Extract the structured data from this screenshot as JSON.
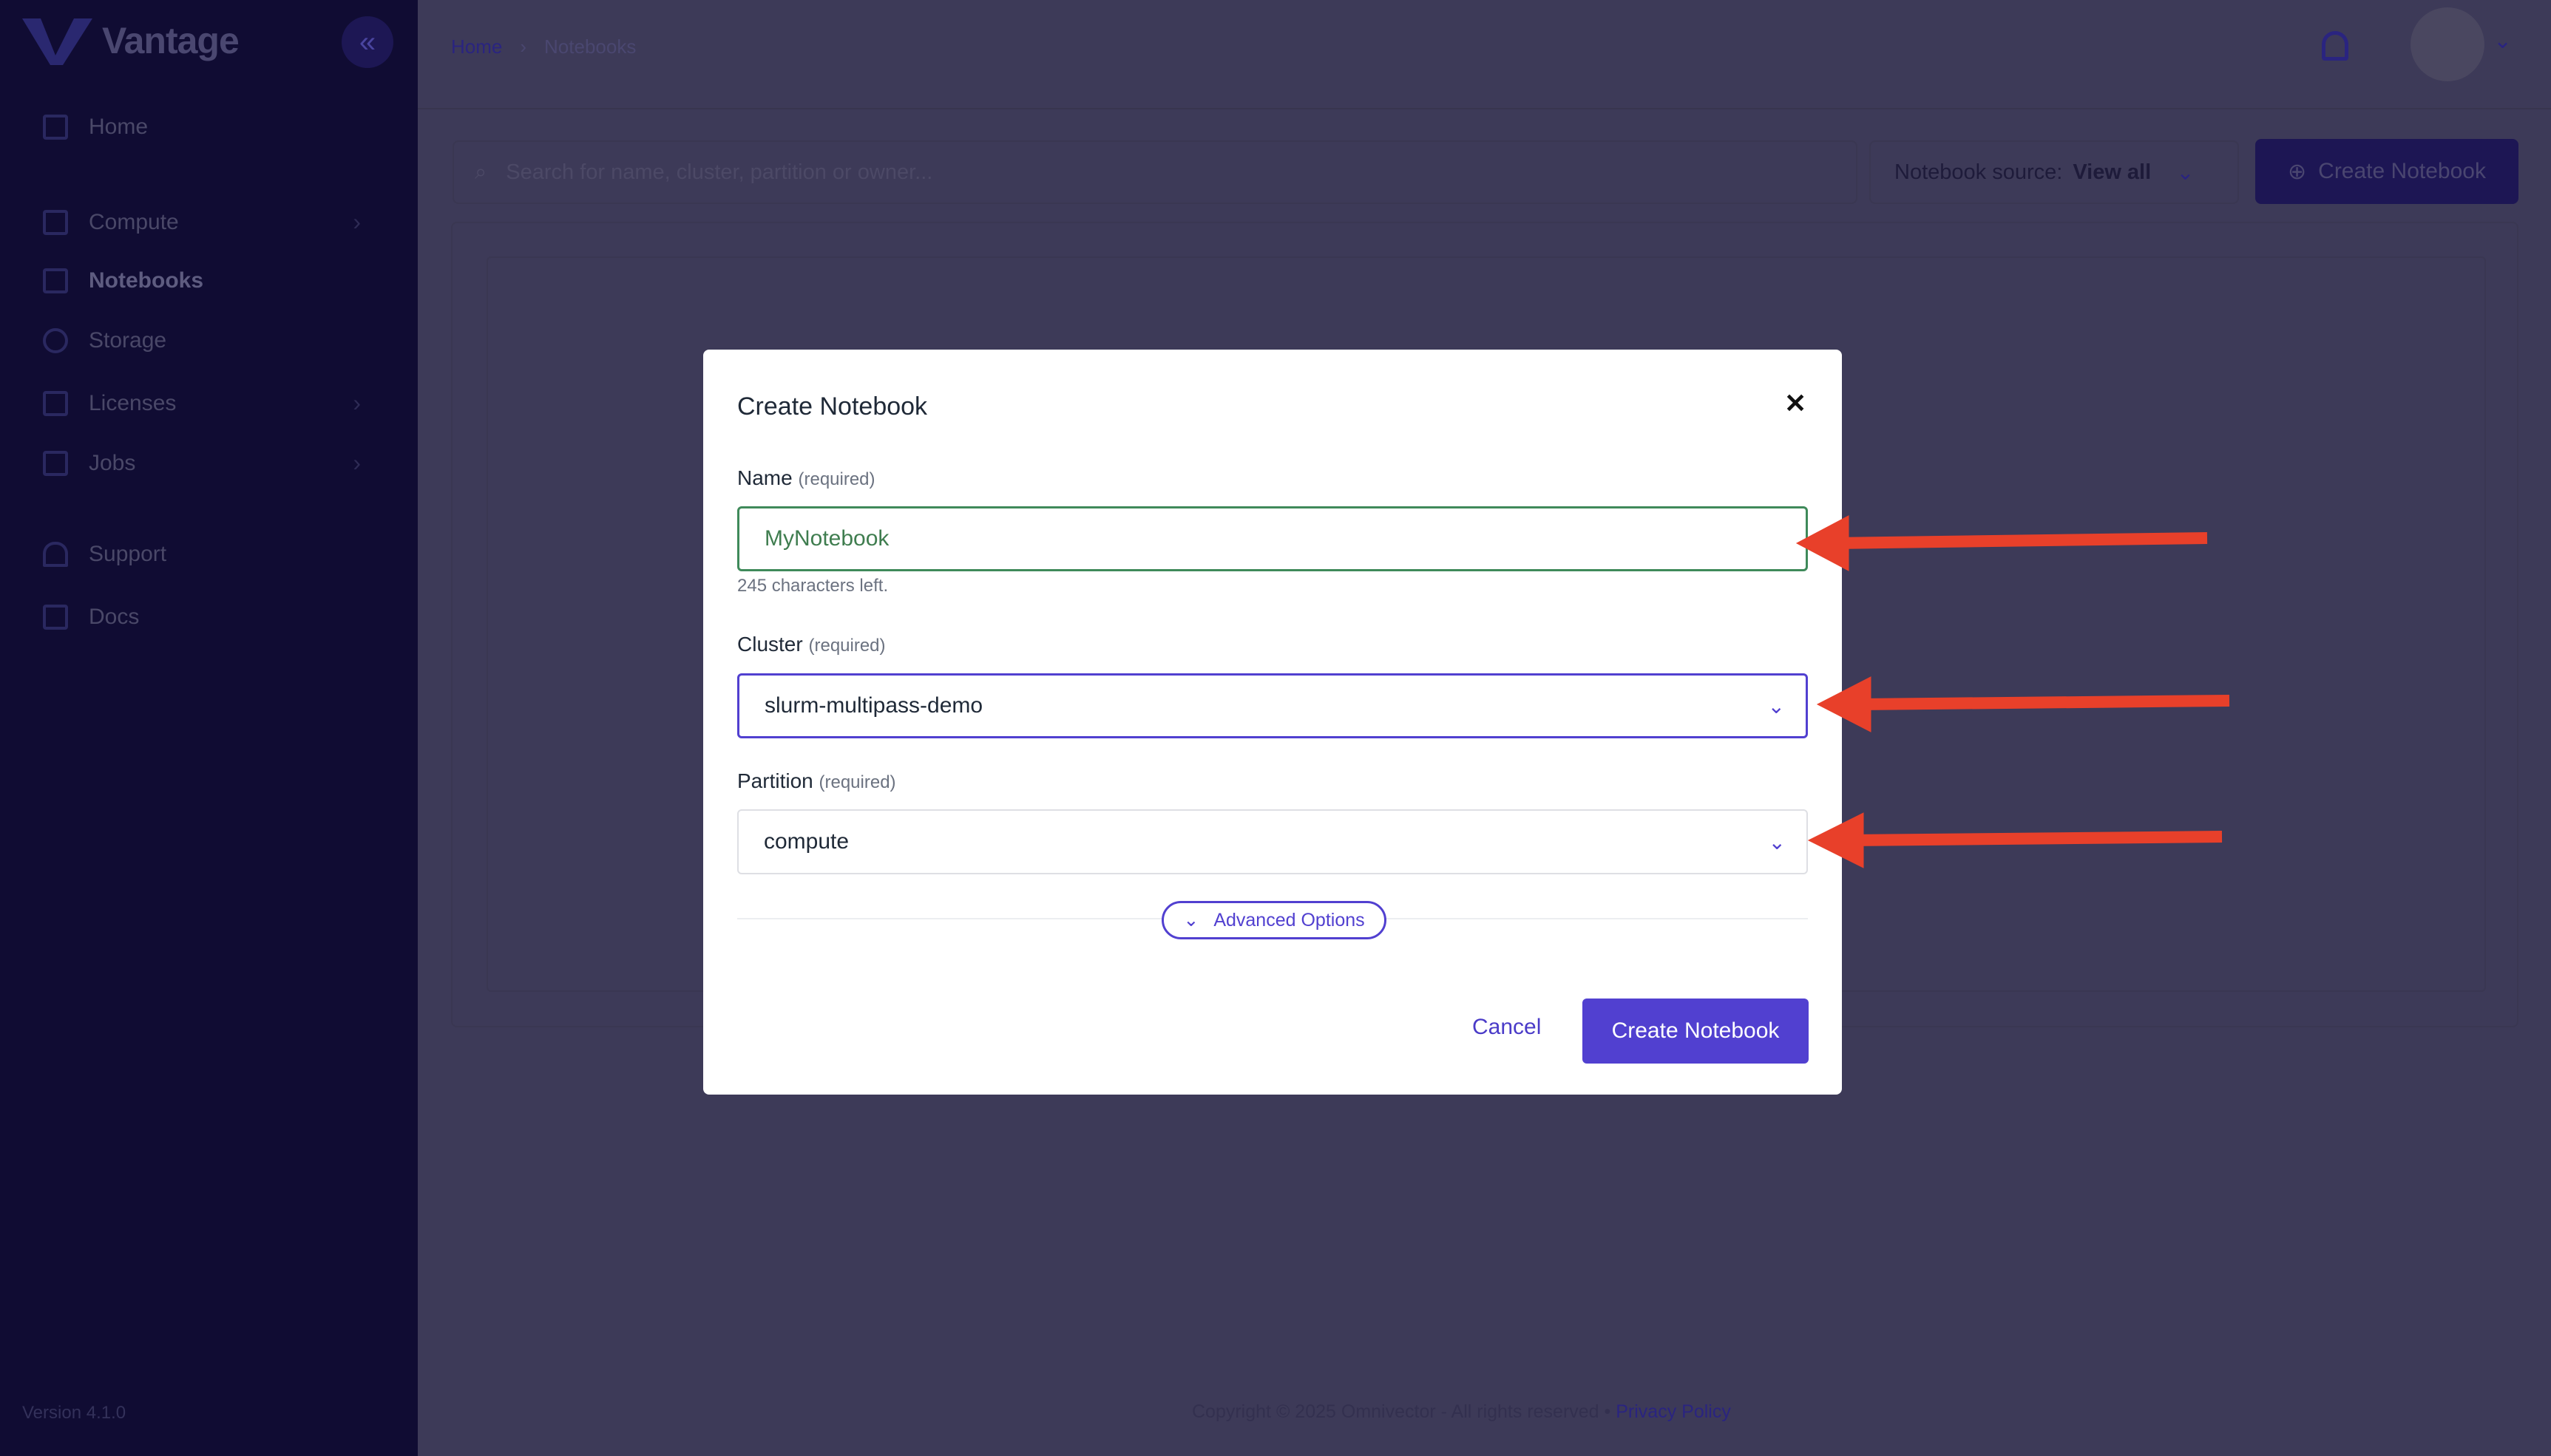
{
  "app": {
    "brand": "Vantage",
    "version": "Version 4.1.0"
  },
  "sidebar": {
    "items": [
      {
        "label": "Home",
        "icon": "dashboard-icon"
      },
      {
        "label": "Compute",
        "icon": "server-icon"
      },
      {
        "label": "Notebooks",
        "icon": "notebook-icon"
      },
      {
        "label": "Storage",
        "icon": "database-icon"
      },
      {
        "label": "Licenses",
        "icon": "clipboard-check-icon"
      },
      {
        "label": "Jobs",
        "icon": "add-copy-icon"
      },
      {
        "label": "Support",
        "icon": "headphones-icon"
      },
      {
        "label": "Docs",
        "icon": "library-icon"
      }
    ]
  },
  "breadcrumb": {
    "home": "Home",
    "current": "Notebooks"
  },
  "toolbar": {
    "search_placeholder": "Search for name, cluster, partition or owner...",
    "source_label": "Notebook source:",
    "source_value": "View all",
    "create_label": "Create Notebook"
  },
  "modal": {
    "title": "Create Notebook",
    "name_label": "Name",
    "name_hint": "(required)",
    "name_value": "MyNotebook",
    "name_help": "245 characters left.",
    "cluster_label": "Cluster",
    "cluster_hint": "(required)",
    "cluster_value": "slurm-multipass-demo",
    "partition_label": "Partition",
    "partition_hint": "(required)",
    "partition_value": "compute",
    "advanced": "Advanced Options",
    "cancel": "Cancel",
    "submit": "Create Notebook"
  },
  "footer": {
    "copyright": "Copyright © 2025 Omnivector - All rights reserved  •  ",
    "privacy": "Privacy Policy"
  },
  "colors": {
    "accent": "#5140d0",
    "valid": "#3f8a5a",
    "annotation": "#e8402a"
  }
}
